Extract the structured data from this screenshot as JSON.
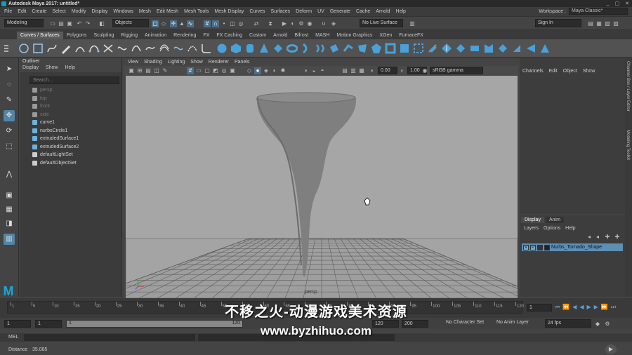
{
  "app": {
    "title": "Autodesk Maya 2017: untitled*"
  },
  "window_controls": [
    "_",
    "▢",
    "✕"
  ],
  "menubar": {
    "items": [
      "File",
      "Edit",
      "Create",
      "Select",
      "Modify",
      "Display",
      "Windows",
      "Mesh",
      "Edit Mesh",
      "Mesh Tools",
      "Mesh Display",
      "Curves",
      "Surfaces",
      "Deform",
      "UV",
      "Generate",
      "Cache",
      "Arnold",
      "Help"
    ],
    "workspace_label": "Workspace :",
    "workspace_value": "Maya Classic*"
  },
  "statusline": {
    "mode": "Modeling",
    "selection_mode": "Objects",
    "live_surface": "No Live Surface",
    "sign_in": "Sign In"
  },
  "shelf": {
    "tabs": [
      "Curves / Surfaces",
      "Polygons",
      "Sculpting",
      "Rigging",
      "Animation",
      "Rendering",
      "FX",
      "FX Caching",
      "Custom",
      "Arnold",
      "Bifrost",
      "MASH",
      "Motion Graphics",
      "XGen",
      "FurnaceFX"
    ],
    "active_tab": "Curves / Surfaces"
  },
  "outliner": {
    "title": "Outliner",
    "menu": [
      "Display",
      "Show",
      "Help"
    ],
    "search_placeholder": "Search...",
    "items": [
      {
        "label": "persp",
        "dim": true,
        "icon": "camera-icon"
      },
      {
        "label": "top",
        "dim": true,
        "icon": "camera-icon"
      },
      {
        "label": "front",
        "dim": true,
        "icon": "camera-icon"
      },
      {
        "label": "side",
        "dim": true,
        "icon": "camera-icon"
      },
      {
        "label": "curve1",
        "dim": false,
        "icon": "curve-icon"
      },
      {
        "label": "nurbsCircle1",
        "dim": false,
        "icon": "curve-icon"
      },
      {
        "label": "extrudedSurface1",
        "dim": false,
        "icon": "surface-icon"
      },
      {
        "label": "extrudedSurface2",
        "dim": false,
        "icon": "surface-icon"
      },
      {
        "label": "defaultLightSet",
        "dim": false,
        "icon": "set-icon"
      },
      {
        "label": "defaultObjectSet",
        "dim": false,
        "icon": "set-icon"
      }
    ]
  },
  "viewport": {
    "menu": [
      "View",
      "Shading",
      "Lighting",
      "Show",
      "Renderer",
      "Panels"
    ],
    "exposure": "0.00",
    "gamma": "1.00",
    "color_space": "sRGB gamma",
    "camera_label": "persp"
  },
  "channelbox": {
    "menu": [
      "Channels",
      "Edit",
      "Object",
      "Show"
    ]
  },
  "layers": {
    "tabs": [
      "Display",
      "Anim"
    ],
    "menu": [
      "Layers",
      "Options",
      "Help"
    ],
    "layer_v": "V",
    "layer_p": "P",
    "layer_name": "Nurbs_Tornado_Shape"
  },
  "side_tabs": [
    "Channel Box / Layer Editor",
    "Modeling Toolkit"
  ],
  "timeline": {
    "ticks": [
      "1",
      "5",
      "10",
      "15",
      "20",
      "25",
      "30",
      "35",
      "40",
      "45",
      "50",
      "55",
      "60",
      "65",
      "70",
      "75",
      "80",
      "85",
      "90",
      "95",
      "100",
      "105",
      "110",
      "115",
      "120"
    ],
    "current_frame": "1"
  },
  "range": {
    "start": "1",
    "anim_start": "1",
    "range_start": "1",
    "range_end": "120",
    "anim_end": "120",
    "end": "200",
    "character_set": "No Character Set",
    "anim_layer": "No Anim Layer",
    "fps": "24 fps"
  },
  "mel": {
    "label": "MEL"
  },
  "help": {
    "label": "Distance",
    "value": "35.085"
  },
  "watermark": {
    "line1": "不移之火-动漫游戏美术资源",
    "line2": "www.byzhihuo.com"
  },
  "colors": {
    "accent": "#5285a6",
    "viewport": "#a3a3a3",
    "layer": "#5d8fb5"
  }
}
